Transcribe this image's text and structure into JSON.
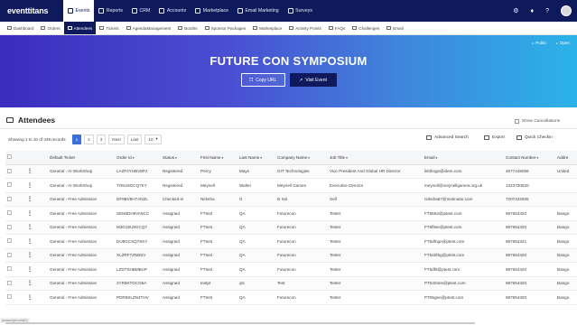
{
  "app": {
    "logo": "eventtitans"
  },
  "topnav": [
    {
      "label": "Events",
      "icon": "calendar-icon",
      "active": true
    },
    {
      "label": "Reports",
      "icon": "report-icon",
      "active": false
    },
    {
      "label": "CRM",
      "icon": "crm-icon",
      "active": false
    },
    {
      "label": "Accounts",
      "icon": "accounts-icon",
      "active": false
    },
    {
      "label": "Marketplace",
      "icon": "marketplace-icon",
      "active": false
    },
    {
      "label": "Email Marketing",
      "icon": "email-icon",
      "active": false
    },
    {
      "label": "Surveys",
      "icon": "survey-icon",
      "active": false
    }
  ],
  "topright": {
    "icons": [
      "settings-icon",
      "bell-icon",
      "help-icon",
      "avatar"
    ]
  },
  "subnav": [
    {
      "label": "Dashboard",
      "active": false
    },
    {
      "label": "Orders",
      "active": false
    },
    {
      "label": "Attendees",
      "active": true
    },
    {
      "label": "Tickets",
      "active": false
    },
    {
      "label": "AgendaManagement",
      "active": false
    },
    {
      "label": "Booths",
      "active": false
    },
    {
      "label": "Sponsor Packages",
      "active": false
    },
    {
      "label": "Marketplace",
      "active": false
    },
    {
      "label": "Activity Points",
      "active": false
    },
    {
      "label": "FAQs",
      "active": false
    },
    {
      "label": "Challenges",
      "active": false
    },
    {
      "label": "Email",
      "active": false
    }
  ],
  "hero": {
    "title": "FUTURE CON SYMPOSIUM",
    "public_label": "Public",
    "open_label": "Open",
    "copy_url": "Copy URL",
    "visit_event": "Visit Event",
    "gradient": [
      "#3b2dbf",
      "#2bb3e8"
    ]
  },
  "attendees": {
    "title": "Attendees",
    "show_cancellations": "Show Cancellations",
    "records_text": "Showing 1 to 10 of 439 records",
    "pages": [
      "1",
      "2",
      "3"
    ],
    "next": "Next",
    "last": "Last",
    "page_size": "10",
    "advanced_search": "Advanced Search",
    "export": "Export",
    "quick_checkin": "Quick Checkin"
  },
  "table": {
    "headers": [
      "Default Ticket",
      "Order Id",
      "Status",
      "First Name",
      "Last Name",
      "Company Name",
      "Job Title",
      "Email",
      "Contact Number",
      "Addre"
    ],
    "rows": [
      [
        "General - AI WorkShop",
        "LAZF4YHBV8PJ",
        "Registered",
        "Percy",
        "Mays",
        "GIT Technologies",
        "Vice President And Global HR Director",
        "listthogs@idem.com",
        "4577445058",
        "United"
      ],
      [
        "General - AI WorkShop",
        "TO5U9GCQ7KY",
        "Registered",
        "Meynell",
        "Walter",
        "Meynell Games",
        "Executive Director",
        "meynell@meynellgames.org.uk",
        "1323730520",
        ""
      ],
      [
        "General - Free Admission",
        "DF9BV8H7ANZL",
        "Checked-in",
        "Nirksha",
        "G",
        "N Sol",
        "Self",
        "nirksha67@motinator.com",
        "7207432505",
        ""
      ],
      [
        "General - Free Admission",
        "SEN6DH9VA6CC",
        "Assigned",
        "FTtest",
        "QA",
        "Futurecon",
        "Tester",
        "FT5653@pitest.com",
        "987654320",
        "Bango"
      ],
      [
        "General - Free Admission",
        "M3G15U9GCQ7",
        "Assigned",
        "FTtest",
        "QA",
        "Futurecon",
        "Tester",
        "FT5fbse@ptest.com",
        "987654320",
        "Bango"
      ],
      [
        "General - Free Admission",
        "DU9GCSQ7SKY",
        "Assigned",
        "FTtest",
        "QA",
        "Futurecon",
        "Tester",
        "FT5dfnge@ptest.com",
        "987654321",
        "Bango"
      ],
      [
        "General - Free Admission",
        "XLZRF7ZNBSV",
        "Assigned",
        "FTtest",
        "QA",
        "Futurecon",
        "Tester",
        "FT5ahf5g@ptest.com",
        "987654320",
        "Bango"
      ],
      [
        "General - Free Admission",
        "LZDTSHBMBAP",
        "Assigned",
        "FTtest",
        "QA",
        "Futurecon",
        "Tester",
        "FT5df5@ptest.com",
        "987654320",
        "Bango"
      ],
      [
        "General - Free Admission",
        "2YR9KTDCO6A",
        "Assigned",
        "testpt",
        "qtc",
        "Test",
        "Tester",
        "PT5404es@ptest.com",
        "987654320",
        "Bango"
      ],
      [
        "General - Free Admission",
        "PDR8SLZN4THV",
        "Assigned",
        "FTtest",
        "QA",
        "Futurecon",
        "Tester",
        "PT55gee@ptest.com",
        "987654320",
        "Bango"
      ]
    ]
  },
  "footer": {
    "status_text": "javascript:void(0)"
  }
}
